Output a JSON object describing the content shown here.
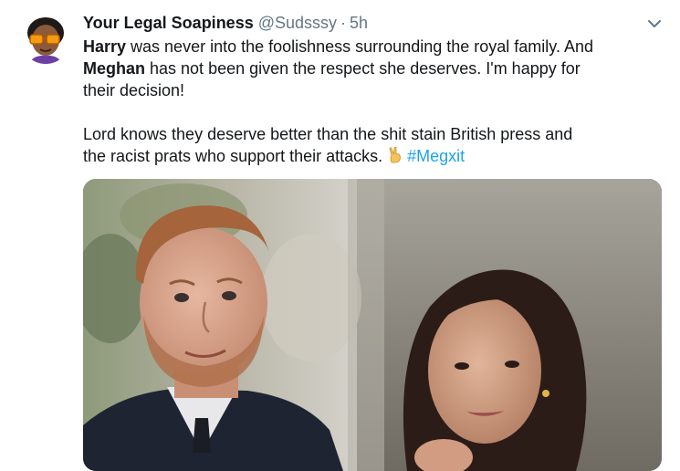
{
  "tweet": {
    "author_name": "Your Legal Soapiness",
    "handle": "@Sudsssy",
    "separator": "·",
    "time": "5h",
    "line1_mention": "Harry",
    "line1_rest": " was never into the foolishness surrounding the royal family. And",
    "line2_mention": "Meghan",
    "line2_rest": " has not been given the respect she deserves.  I'm happy for",
    "line3": "their decision!",
    "para2_line1": "Lord knows they deserve better than the shit stain British press and",
    "para2_line2": "the racist prats who support their attacks.",
    "hashtag": "#Megxit",
    "emoji_icon": "victory-hand-icon"
  },
  "colors": {
    "link": "#1da1f2",
    "secondary_text": "#657786",
    "primary_text": "#14171a"
  }
}
